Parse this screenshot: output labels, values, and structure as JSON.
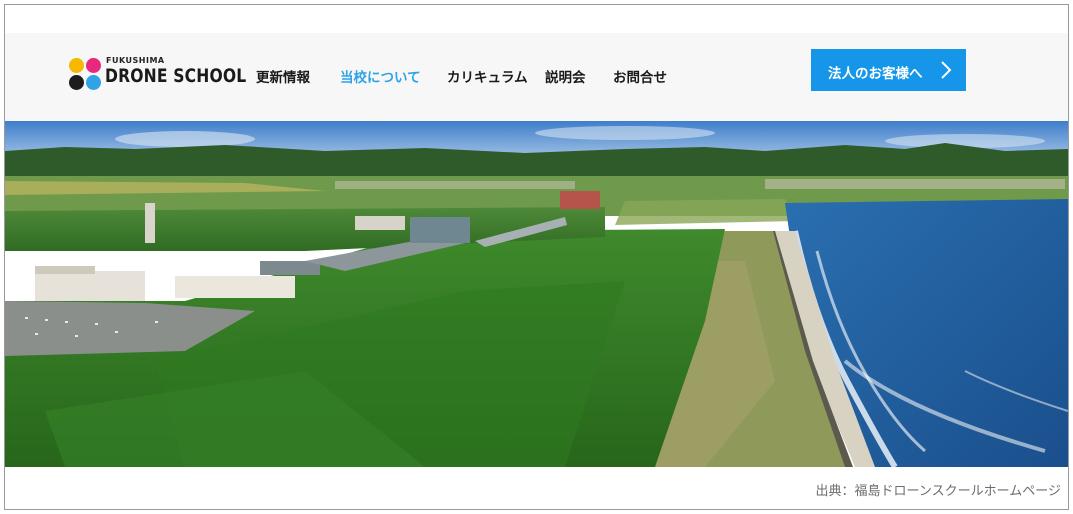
{
  "logo": {
    "small": "FUKUSHIMA",
    "main": "DRONE SCHOOL",
    "dot_colors": [
      "#f6b800",
      "#e8287d",
      "#1c1c1c",
      "#2fa3e6"
    ]
  },
  "nav": {
    "items": [
      {
        "label": "更新情報",
        "active": false
      },
      {
        "label": "当校について",
        "active": true
      },
      {
        "label": "カリキュラム",
        "active": false
      },
      {
        "label": "説明会",
        "active": false
      },
      {
        "label": "お問合せ",
        "active": false
      }
    ],
    "active_color": "#2fa3e6"
  },
  "cta": {
    "label": "法人のお客様へ",
    "icon": "chevron-right-icon",
    "color": "#1596e8"
  },
  "hero": {
    "image": "aerial-coastline-photo"
  },
  "caption": "出典：福島ドローンスクールホームページ"
}
